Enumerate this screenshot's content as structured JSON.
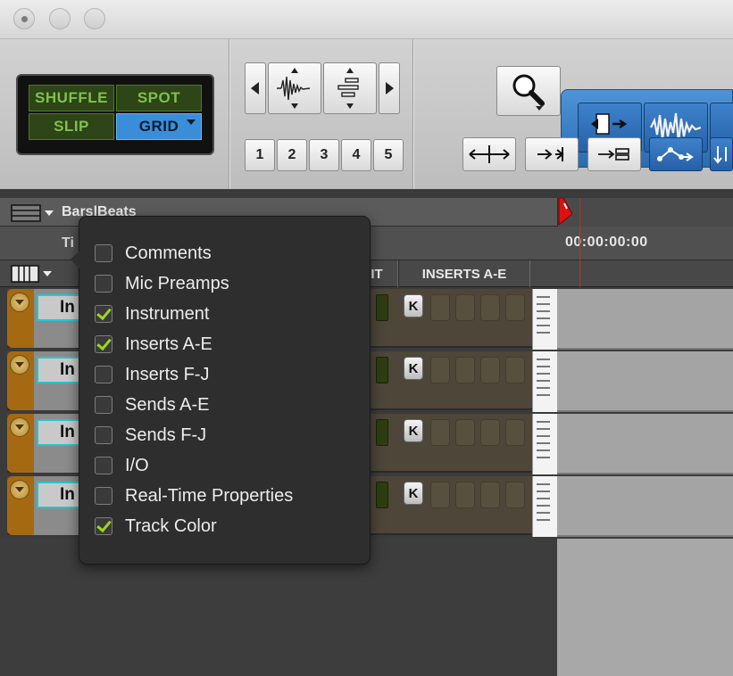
{
  "toolbar": {
    "edit_modes": [
      {
        "label": "SHUFFLE",
        "active": false
      },
      {
        "label": "SPOT",
        "active": false
      },
      {
        "label": "SLIP",
        "active": false
      },
      {
        "label": "GRID",
        "active": true
      }
    ],
    "zoom_presets": [
      "1",
      "2",
      "3",
      "4",
      "5"
    ],
    "icons": {
      "zoom_tool": "magnifier-icon",
      "trim_tool": "trim-tool-icon",
      "selector_tool": "selector-waveform-icon",
      "nav_left": "triangle-left-icon",
      "nav_right": "triangle-right-icon"
    }
  },
  "ruler": {
    "bars_beats_label": "Bars|Beats",
    "timecode_label_partial": "Ti",
    "timecode_value": "00:00:00:00"
  },
  "columns": {
    "instrument_partial": "IT",
    "inserts": "INSERTS A-E"
  },
  "tracks": [
    {
      "name_partial": "In",
      "insert_label": "K"
    },
    {
      "name_partial": "In",
      "insert_label": "K"
    },
    {
      "name_partial": "In",
      "insert_label": "K"
    },
    {
      "name_partial": "In",
      "insert_label": "K"
    }
  ],
  "popup_menu": {
    "items": [
      {
        "label": "Comments",
        "checked": false
      },
      {
        "label": "Mic Preamps",
        "checked": false
      },
      {
        "label": "Instrument",
        "checked": true
      },
      {
        "label": "Inserts A-E",
        "checked": true
      },
      {
        "label": "Inserts F-J",
        "checked": false
      },
      {
        "label": "Sends A-E",
        "checked": false
      },
      {
        "label": "Sends F-J",
        "checked": false
      },
      {
        "label": "I/O",
        "checked": false
      },
      {
        "label": "Real-Time Properties",
        "checked": false
      },
      {
        "label": "Track Color",
        "checked": true
      }
    ]
  },
  "colors": {
    "track_color": "#a56a11",
    "grid_active": "#3a8ed9",
    "mode_text": "#7fc14b",
    "check": "#9bd81a",
    "playhead": "#dd2222"
  }
}
